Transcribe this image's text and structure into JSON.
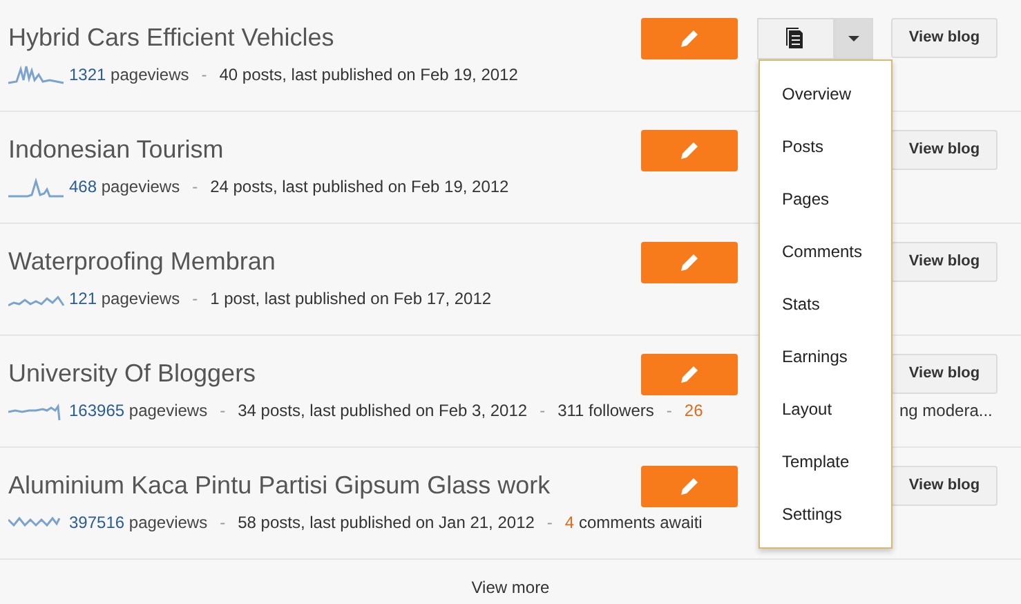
{
  "blogs": [
    {
      "title": "Hybrid Cars Efficient Vehicles",
      "view_label": "View blog",
      "stats": [
        {
          "kind": "pageviews",
          "count": "1321",
          "label": "pageviews"
        },
        {
          "kind": "separator",
          "text": "-"
        },
        {
          "kind": "text",
          "text": "40 posts, last published on Feb 19, 2012"
        }
      ],
      "manage_menu": {
        "expanded": true,
        "items": [
          "Overview",
          "Posts",
          "Pages",
          "Comments",
          "Stats",
          "Earnings",
          "Layout",
          "Template",
          "Settings"
        ]
      }
    },
    {
      "title": "Indonesian Tourism",
      "view_label": "View blog",
      "stats": [
        {
          "kind": "pageviews",
          "count": "468",
          "label": "pageviews"
        },
        {
          "kind": "separator",
          "text": "-"
        },
        {
          "kind": "text",
          "text": "24 posts, last published on Feb 19, 2012"
        }
      ]
    },
    {
      "title": "Waterproofing Membran",
      "view_label": "View blog",
      "stats": [
        {
          "kind": "pageviews",
          "count": "121",
          "label": "pageviews"
        },
        {
          "kind": "separator",
          "text": "-"
        },
        {
          "kind": "text",
          "text": "1 post, last published on Feb 17, 2012"
        }
      ]
    },
    {
      "title": "University Of Bloggers",
      "view_label": "View blog",
      "stats": [
        {
          "kind": "pageviews",
          "count": "163965",
          "label": "pageviews"
        },
        {
          "kind": "separator",
          "text": "-"
        },
        {
          "kind": "text",
          "text": "34 posts, last published on Feb 3, 2012"
        },
        {
          "kind": "separator",
          "text": "-"
        },
        {
          "kind": "text",
          "text": "311 followers"
        },
        {
          "kind": "separator",
          "text": "-"
        },
        {
          "kind": "alert",
          "count": "26"
        },
        {
          "kind": "continued",
          "text": "ng modera..."
        }
      ]
    },
    {
      "title": "Aluminium Kaca Pintu Partisi Gipsum Glass work",
      "view_label": "View blog",
      "stats": [
        {
          "kind": "pageviews",
          "count": "397516",
          "label": "pageviews"
        },
        {
          "kind": "separator",
          "text": "-"
        },
        {
          "kind": "text",
          "text": "58 posts, last published on Jan 21, 2012"
        },
        {
          "kind": "separator",
          "text": "-"
        },
        {
          "kind": "alert",
          "count": "4",
          "text": "comments awaiti"
        }
      ]
    }
  ],
  "view_more": "View more"
}
